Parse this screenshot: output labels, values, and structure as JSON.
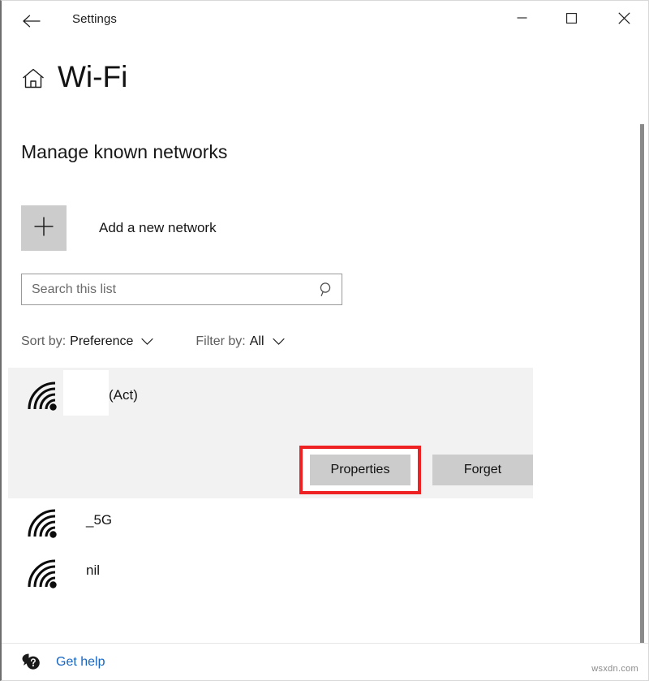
{
  "window": {
    "title": "Settings",
    "back_icon": "back-arrow-icon",
    "minimize_label": "–",
    "maximize_label": "□",
    "close_label": "✕"
  },
  "page": {
    "home_icon": "home-icon",
    "title": "Wi-Fi",
    "section_heading": "Manage known networks"
  },
  "add_network": {
    "icon": "plus-icon",
    "label": "Add a new network"
  },
  "search": {
    "placeholder": "Search this list",
    "value": "",
    "icon": "search-icon"
  },
  "filters": {
    "sort": {
      "label": "Sort by:",
      "value": "Preference",
      "chevron": "chevron-down-icon"
    },
    "filter": {
      "label": "Filter by:",
      "value": "All",
      "chevron": "chevron-down-icon"
    }
  },
  "networks": [
    {
      "name": "(Act)",
      "icon": "wifi-signal-icon",
      "selected": true,
      "redacted": true,
      "actions": {
        "properties_label": "Properties",
        "forget_label": "Forget"
      }
    },
    {
      "name": "_5G",
      "icon": "wifi-signal-icon",
      "selected": false,
      "redacted": false
    },
    {
      "name": "nil",
      "icon": "wifi-signal-icon",
      "selected": false,
      "redacted": false
    }
  ],
  "highlight": {
    "target": "Properties",
    "color": "#ee2222"
  },
  "footer": {
    "help_icon": "help-question-bubble-icon",
    "help_label": "Get help",
    "watermark": "wsxdn.com"
  },
  "colors": {
    "accent_link": "#1766c0",
    "selected_row": "#f2f2f2",
    "button_face": "#cccccc",
    "highlight": "#ee2222"
  }
}
